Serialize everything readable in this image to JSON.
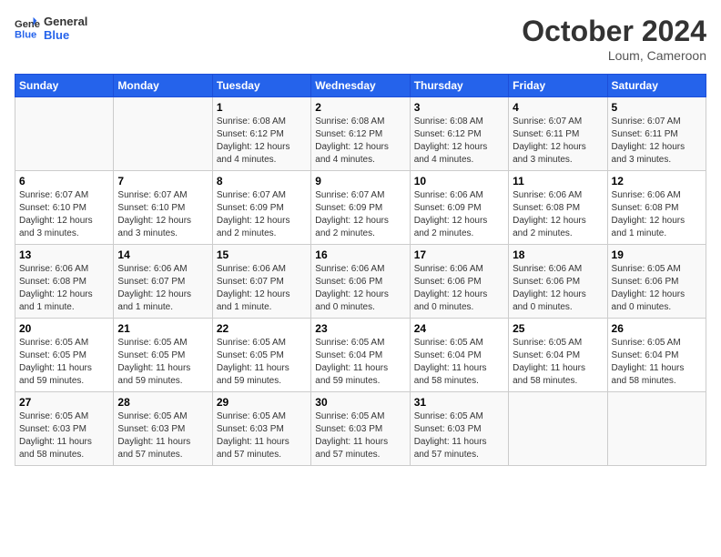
{
  "logo": {
    "line1": "General",
    "line2": "Blue"
  },
  "title": "October 2024",
  "location": "Loum, Cameroon",
  "days_of_week": [
    "Sunday",
    "Monday",
    "Tuesday",
    "Wednesday",
    "Thursday",
    "Friday",
    "Saturday"
  ],
  "weeks": [
    [
      {
        "num": "",
        "info": ""
      },
      {
        "num": "",
        "info": ""
      },
      {
        "num": "1",
        "info": "Sunrise: 6:08 AM\nSunset: 6:12 PM\nDaylight: 12 hours\nand 4 minutes."
      },
      {
        "num": "2",
        "info": "Sunrise: 6:08 AM\nSunset: 6:12 PM\nDaylight: 12 hours\nand 4 minutes."
      },
      {
        "num": "3",
        "info": "Sunrise: 6:08 AM\nSunset: 6:12 PM\nDaylight: 12 hours\nand 4 minutes."
      },
      {
        "num": "4",
        "info": "Sunrise: 6:07 AM\nSunset: 6:11 PM\nDaylight: 12 hours\nand 3 minutes."
      },
      {
        "num": "5",
        "info": "Sunrise: 6:07 AM\nSunset: 6:11 PM\nDaylight: 12 hours\nand 3 minutes."
      }
    ],
    [
      {
        "num": "6",
        "info": "Sunrise: 6:07 AM\nSunset: 6:10 PM\nDaylight: 12 hours\nand 3 minutes."
      },
      {
        "num": "7",
        "info": "Sunrise: 6:07 AM\nSunset: 6:10 PM\nDaylight: 12 hours\nand 3 minutes."
      },
      {
        "num": "8",
        "info": "Sunrise: 6:07 AM\nSunset: 6:09 PM\nDaylight: 12 hours\nand 2 minutes."
      },
      {
        "num": "9",
        "info": "Sunrise: 6:07 AM\nSunset: 6:09 PM\nDaylight: 12 hours\nand 2 minutes."
      },
      {
        "num": "10",
        "info": "Sunrise: 6:06 AM\nSunset: 6:09 PM\nDaylight: 12 hours\nand 2 minutes."
      },
      {
        "num": "11",
        "info": "Sunrise: 6:06 AM\nSunset: 6:08 PM\nDaylight: 12 hours\nand 2 minutes."
      },
      {
        "num": "12",
        "info": "Sunrise: 6:06 AM\nSunset: 6:08 PM\nDaylight: 12 hours\nand 1 minute."
      }
    ],
    [
      {
        "num": "13",
        "info": "Sunrise: 6:06 AM\nSunset: 6:08 PM\nDaylight: 12 hours\nand 1 minute."
      },
      {
        "num": "14",
        "info": "Sunrise: 6:06 AM\nSunset: 6:07 PM\nDaylight: 12 hours\nand 1 minute."
      },
      {
        "num": "15",
        "info": "Sunrise: 6:06 AM\nSunset: 6:07 PM\nDaylight: 12 hours\nand 1 minute."
      },
      {
        "num": "16",
        "info": "Sunrise: 6:06 AM\nSunset: 6:06 PM\nDaylight: 12 hours\nand 0 minutes."
      },
      {
        "num": "17",
        "info": "Sunrise: 6:06 AM\nSunset: 6:06 PM\nDaylight: 12 hours\nand 0 minutes."
      },
      {
        "num": "18",
        "info": "Sunrise: 6:06 AM\nSunset: 6:06 PM\nDaylight: 12 hours\nand 0 minutes."
      },
      {
        "num": "19",
        "info": "Sunrise: 6:05 AM\nSunset: 6:06 PM\nDaylight: 12 hours\nand 0 minutes."
      }
    ],
    [
      {
        "num": "20",
        "info": "Sunrise: 6:05 AM\nSunset: 6:05 PM\nDaylight: 11 hours\nand 59 minutes."
      },
      {
        "num": "21",
        "info": "Sunrise: 6:05 AM\nSunset: 6:05 PM\nDaylight: 11 hours\nand 59 minutes."
      },
      {
        "num": "22",
        "info": "Sunrise: 6:05 AM\nSunset: 6:05 PM\nDaylight: 11 hours\nand 59 minutes."
      },
      {
        "num": "23",
        "info": "Sunrise: 6:05 AM\nSunset: 6:04 PM\nDaylight: 11 hours\nand 59 minutes."
      },
      {
        "num": "24",
        "info": "Sunrise: 6:05 AM\nSunset: 6:04 PM\nDaylight: 11 hours\nand 58 minutes."
      },
      {
        "num": "25",
        "info": "Sunrise: 6:05 AM\nSunset: 6:04 PM\nDaylight: 11 hours\nand 58 minutes."
      },
      {
        "num": "26",
        "info": "Sunrise: 6:05 AM\nSunset: 6:04 PM\nDaylight: 11 hours\nand 58 minutes."
      }
    ],
    [
      {
        "num": "27",
        "info": "Sunrise: 6:05 AM\nSunset: 6:03 PM\nDaylight: 11 hours\nand 58 minutes."
      },
      {
        "num": "28",
        "info": "Sunrise: 6:05 AM\nSunset: 6:03 PM\nDaylight: 11 hours\nand 57 minutes."
      },
      {
        "num": "29",
        "info": "Sunrise: 6:05 AM\nSunset: 6:03 PM\nDaylight: 11 hours\nand 57 minutes."
      },
      {
        "num": "30",
        "info": "Sunrise: 6:05 AM\nSunset: 6:03 PM\nDaylight: 11 hours\nand 57 minutes."
      },
      {
        "num": "31",
        "info": "Sunrise: 6:05 AM\nSunset: 6:03 PM\nDaylight: 11 hours\nand 57 minutes."
      },
      {
        "num": "",
        "info": ""
      },
      {
        "num": "",
        "info": ""
      }
    ]
  ]
}
